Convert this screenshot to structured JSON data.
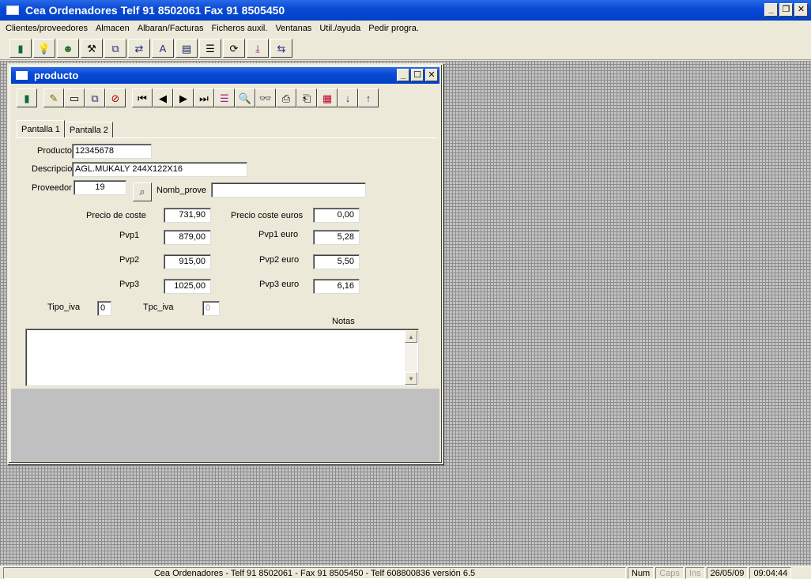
{
  "app": {
    "title": "Cea Ordenadores Telf 91 8502061 Fax 91 8505450",
    "window_buttons": {
      "minimize": "_",
      "restore": "❐",
      "close": "✕"
    }
  },
  "menu": [
    "Clientes/proveedores",
    "Almacen",
    "Albaran/Facturas",
    "Ficheros auxil.",
    "Ventanas",
    "Util./ayuda",
    "Pedir progra."
  ],
  "main_toolbar_icons": [
    {
      "name": "exit-door-icon",
      "glyph": "▮"
    },
    {
      "name": "lightbulb-icon",
      "glyph": "💡"
    },
    {
      "name": "agent-face-icon",
      "glyph": "☻"
    },
    {
      "name": "tools-icon",
      "glyph": "⚒"
    },
    {
      "name": "copy-windows-icon",
      "glyph": "⧉"
    },
    {
      "name": "transfer-ab-icon",
      "glyph": "⇄"
    },
    {
      "name": "font-aa-icon",
      "glyph": "A"
    },
    {
      "name": "book-abc-icon",
      "glyph": "▤"
    },
    {
      "name": "document-list-icon",
      "glyph": "☰"
    },
    {
      "name": "refresh-document-icon",
      "glyph": "⟳"
    },
    {
      "name": "document-export-icon",
      "glyph": "⤓"
    },
    {
      "name": "transfer-ab2-icon",
      "glyph": "⇆"
    }
  ],
  "child_window": {
    "title": "producto",
    "window_buttons": {
      "minimize": "_",
      "maximize": "☐",
      "close": "✕"
    },
    "toolbar_icons": [
      {
        "name": "exit-door-icon",
        "glyph": "▮"
      },
      {
        "name": "edit-pencil-icon",
        "glyph": "✎"
      },
      {
        "name": "new-record-icon",
        "glyph": "▭"
      },
      {
        "name": "duplicate-icon",
        "glyph": "⧉"
      },
      {
        "name": "delete-icon",
        "glyph": "⊘"
      },
      {
        "name": "first-record-icon",
        "glyph": "⏮"
      },
      {
        "name": "previous-record-icon",
        "glyph": "◀"
      },
      {
        "name": "next-record-icon",
        "glyph": "▶"
      },
      {
        "name": "last-record-icon",
        "glyph": "⏭"
      },
      {
        "name": "list-view-icon",
        "glyph": "☰"
      },
      {
        "name": "preview-icon",
        "glyph": "🔍"
      },
      {
        "name": "binoculars-icon",
        "glyph": "👓"
      },
      {
        "name": "print-icon",
        "glyph": "⎙"
      },
      {
        "name": "print-setup-icon",
        "glyph": "⎗"
      },
      {
        "name": "grid-icon",
        "glyph": "▦"
      },
      {
        "name": "sort-ascending-icon",
        "glyph": "↓"
      },
      {
        "name": "sort-descending-icon",
        "glyph": "↑"
      }
    ],
    "tabs": [
      "Pantalla 1",
      "Pantalla 2"
    ],
    "form": {
      "producto_label": "Producto",
      "producto_value": "12345678",
      "descripcion_label": "Descripcio",
      "descripcion_value": "AGL.MUKALY 244X122X16",
      "proveedor_label": "Proveedor",
      "proveedor_value": "19",
      "nomb_prove_label": "Nomb_prove",
      "nomb_prove_value": "",
      "precio_coste_label": "Precio de coste",
      "precio_coste_value": "731,90",
      "precio_coste_euros_label": "Precio coste euros",
      "precio_coste_euros_value": "0,00",
      "pvp1_label": "Pvp1",
      "pvp1_value": "879,00",
      "pvp1_euro_label": "Pvp1 euro",
      "pvp1_euro_value": "5,28",
      "pvp2_label": "Pvp2",
      "pvp2_value": "915,00",
      "pvp2_euro_label": "Pvp2 euro",
      "pvp2_euro_value": "5,50",
      "pvp3_label": "Pvp3",
      "pvp3_value": "1025,00",
      "pvp3_euro_label": "Pvp3 euro",
      "pvp3_euro_value": "6,16",
      "tipo_iva_label": "Tipo_iva",
      "tipo_iva_value": "0",
      "tpc_iva_label": "Tpc_iva",
      "tpc_iva_value": "0",
      "notas_label": "Notas",
      "notas_value": ""
    }
  },
  "status_bar": {
    "main": "Cea Ordenadores - Telf 91 8502061 - Fax 91 8505450 - Telf 608800836 versión 6.5",
    "num": "Num",
    "caps": "Caps",
    "ins": "Ins",
    "date": "26/05/09",
    "time": "09:04:44"
  }
}
